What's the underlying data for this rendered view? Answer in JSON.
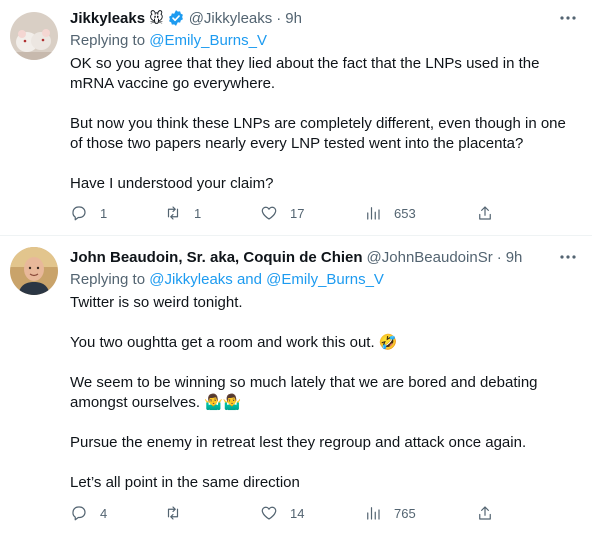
{
  "tweets": [
    {
      "name": "Jikkyleaks",
      "name_emoji": "🐭",
      "handle": "@Jikkyleaks",
      "separator": "·",
      "time": "9h",
      "replying_prefix": "Replying to ",
      "replying_to": "@Emily_Burns_V",
      "paragraphs": [
        "OK so you agree that they lied about the fact that the LNPs used in the mRNA vaccine go everywhere.",
        "But now you think these LNPs are completely different, even though in one of those two papers nearly every LNP tested went into the placenta?",
        "Have I understood your claim?"
      ],
      "replies": "1",
      "retweets": "1",
      "likes": "17",
      "views": "653"
    },
    {
      "name": "John Beaudoin, Sr. aka, Coquin de Chien",
      "handle": "@JohnBeaudoinSr",
      "separator": "·",
      "time": "9h",
      "replying_prefix": "Replying to ",
      "replying_to_1": "@Jikkyleaks",
      "replying_and": " and ",
      "replying_to_2": "@Emily_Burns_V",
      "paragraphs": [
        "Twitter is so weird tonight.",
        "You two oughtta get a room and work this out. 🤣",
        "We seem to be winning so much lately that we are bored and debating amongst ourselves. 🤷‍♂️🤷‍♂️",
        "Pursue the enemy in retreat lest they regroup and attack once again.",
        "Let’s all point in the same direction"
      ],
      "replies": "4",
      "retweets": "",
      "likes": "14",
      "views": "765"
    }
  ],
  "colors": {
    "link": "#1d9bf0",
    "secondary_text": "#536471",
    "verified": "#1d9bf0",
    "divider": "#eff3f4"
  },
  "icons": [
    "reply-icon",
    "retweet-icon",
    "like-icon",
    "views-icon",
    "share-icon",
    "more-icon",
    "verified-badge-icon"
  ]
}
